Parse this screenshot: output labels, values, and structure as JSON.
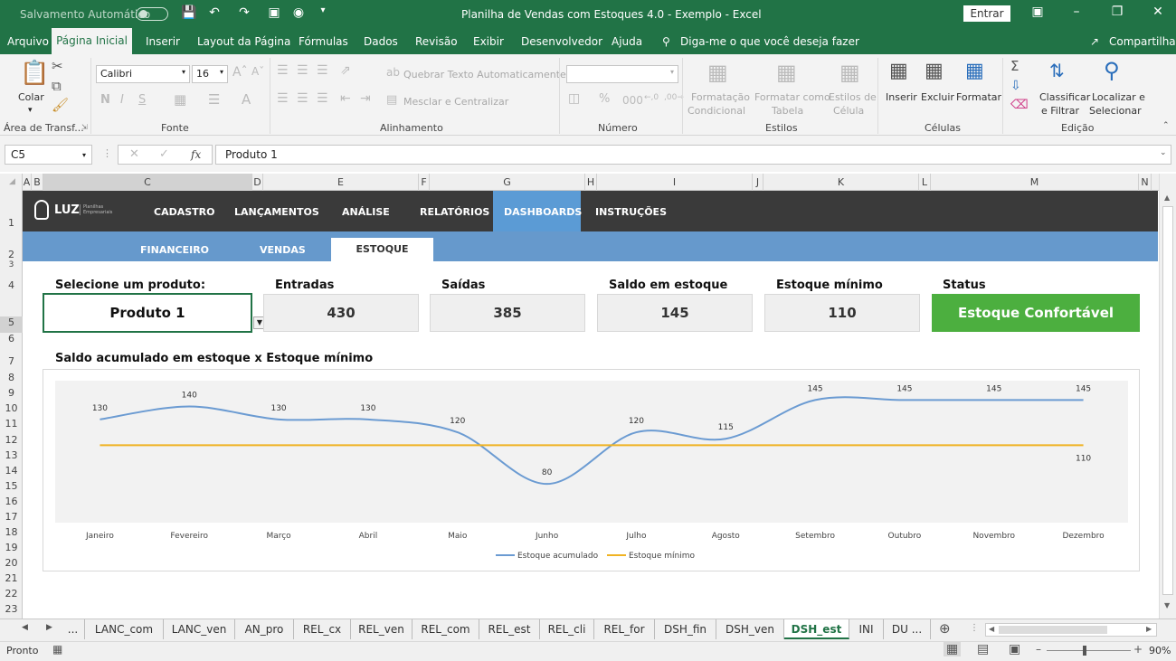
{
  "window": {
    "autosave": "Salvamento Automático",
    "title": "Planilha de Vendas com Estoques 4.0 - Exemplo  -  Excel",
    "signin": "Entrar"
  },
  "menu": {
    "file": "Arquivo",
    "home": "Página Inicial",
    "insert": "Inserir",
    "layout": "Layout da Página",
    "formulas": "Fórmulas",
    "data": "Dados",
    "review": "Revisão",
    "view": "Exibir",
    "developer": "Desenvolvedor",
    "help": "Ajuda",
    "tellme": "Diga-me o que você deseja fazer",
    "share": "Compartilhar"
  },
  "ribbon": {
    "paste": "Colar",
    "clipboard": "Área de Transf...",
    "font_name": "Calibri",
    "font_size": "16",
    "font_group": "Fonte",
    "wrap": "Quebrar Texto Automaticamente",
    "merge": "Mesclar e Centralizar",
    "align_group": "Alinhamento",
    "number_group": "Número",
    "number_format": "",
    "cond1": "Formatação",
    "cond2": "Condicional",
    "fmt1": "Formatar como",
    "fmt2": "Tabela",
    "sty1": "Estilos de",
    "sty2": "Célula",
    "styles_group": "Estilos",
    "ins": "Inserir",
    "del": "Excluir",
    "fmt": "Formatar",
    "cells_group": "Células",
    "sort1": "Classificar",
    "sort2": "e Filtrar",
    "find1": "Localizar e",
    "find2": "Selecionar",
    "edit_group": "Edição"
  },
  "formula_bar": {
    "name_box": "C5",
    "fx": "fx",
    "formula": "Produto 1"
  },
  "columns": [
    "A",
    "B",
    "C",
    "D",
    "E",
    "F",
    "G",
    "H",
    "I",
    "J",
    "K",
    "L",
    "M",
    "N"
  ],
  "rows": [
    "1",
    "2",
    "3",
    "4",
    "5",
    "6",
    "7",
    "8",
    "9",
    "10",
    "11",
    "12",
    "13",
    "14",
    "15",
    "16",
    "17",
    "18",
    "19",
    "20",
    "21",
    "22",
    "23"
  ],
  "nav": {
    "logo": "LUZ",
    "logo_sub": "Planilhas Empresariais",
    "items": [
      "CADASTRO",
      "LANÇAMENTOS",
      "ANÁLISE",
      "RELATÓRIOS",
      "DASHBOARDS",
      "INSTRUÇÕES"
    ],
    "sub_items": [
      "FINANCEIRO",
      "VENDAS",
      "ESTOQUE"
    ]
  },
  "kpis": {
    "select_label": "Selecione um produto:",
    "product": "Produto 1",
    "in_label": "Entradas",
    "in_value": "430",
    "out_label": "Saídas",
    "out_value": "385",
    "balance_label": "Saldo em estoque",
    "balance_value": "145",
    "min_label": "Estoque mínimo",
    "min_value": "110",
    "status_label": "Status",
    "status_value": "Estoque Confortável",
    "status_color": "#4caf3f"
  },
  "chart_data": {
    "type": "line",
    "title": "Saldo acumulado em estoque x Estoque mínimo",
    "categories": [
      "Janeiro",
      "Fevereiro",
      "Março",
      "Abril",
      "Maio",
      "Junho",
      "Julho",
      "Agosto",
      "Setembro",
      "Outubro",
      "Novembro",
      "Dezembro"
    ],
    "series": [
      {
        "name": "Estoque acumulado",
        "color": "#6b9bd2",
        "values": [
          130,
          140,
          130,
          130,
          120,
          80,
          120,
          115,
          145,
          145,
          145,
          145
        ]
      },
      {
        "name": "Estoque mínimo",
        "color": "#f0b323",
        "values": [
          110,
          110,
          110,
          110,
          110,
          110,
          110,
          110,
          110,
          110,
          110,
          110
        ]
      }
    ],
    "ylim": [
      50,
      160
    ],
    "grid": false,
    "legend": "bottom"
  },
  "sheet_tabs": [
    "...",
    "LANC_com",
    "LANC_ven",
    "AN_pro",
    "REL_cx",
    "REL_ven",
    "REL_com",
    "REL_est",
    "REL_cli",
    "REL_for",
    "DSH_fin",
    "DSH_ven",
    "DSH_est",
    "INI",
    "DU ..."
  ],
  "status": {
    "ready": "Pronto",
    "zoom": "90%"
  }
}
